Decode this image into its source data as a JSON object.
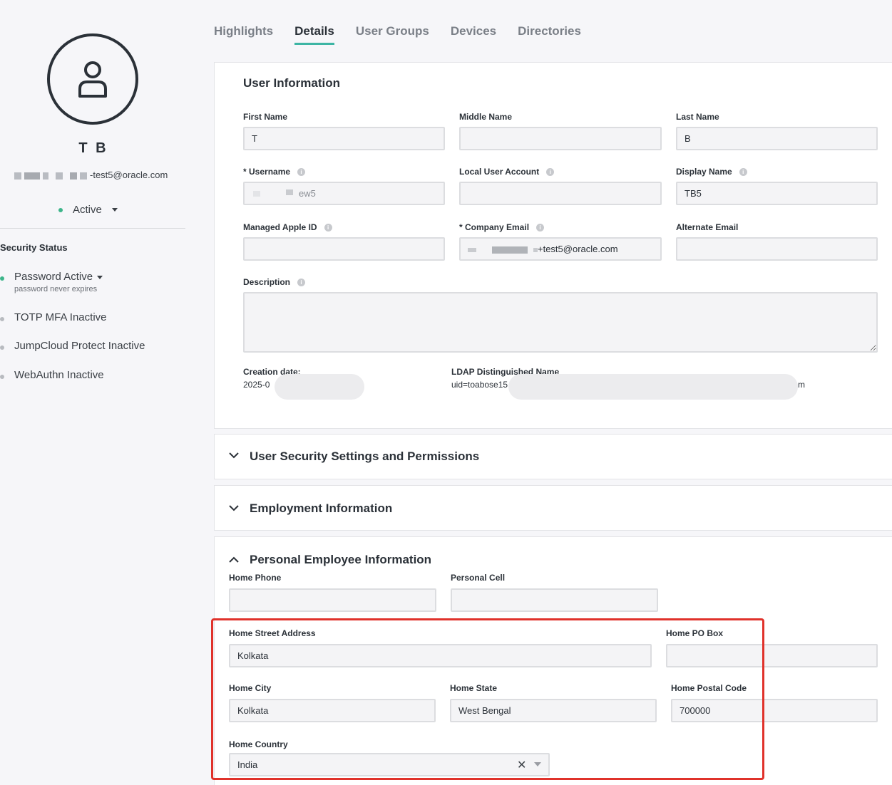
{
  "profile": {
    "initials": "T B",
    "email_visible": "-test5@oracle.com",
    "status": "Active",
    "status_color": "#3db58a"
  },
  "security": {
    "title": "Security Status",
    "items": [
      {
        "label": "Password Active",
        "sub": "password never expires",
        "color": "#3db58a",
        "dropdown": true
      },
      {
        "label": "TOTP MFA Inactive",
        "color": "#b8bbc0"
      },
      {
        "label": "JumpCloud Protect Inactive",
        "color": "#b8bbc0"
      },
      {
        "label": "WebAuthn Inactive",
        "color": "#b8bbc0"
      }
    ]
  },
  "tabs": [
    "Highlights",
    "Details",
    "User Groups",
    "Devices",
    "Directories"
  ],
  "active_tab": "Details",
  "user_info": {
    "title": "User Information",
    "first_name": {
      "label": "First Name",
      "value": "T"
    },
    "middle_name": {
      "label": "Middle Name",
      "value": ""
    },
    "last_name": {
      "label": "Last Name",
      "value": "B"
    },
    "username": {
      "label": "* Username",
      "value": "ew5"
    },
    "local_account": {
      "label": "Local User Account",
      "value": ""
    },
    "display_name": {
      "label": "Display Name",
      "value": "TB5"
    },
    "apple_id": {
      "label": "Managed Apple ID",
      "value": ""
    },
    "company_email": {
      "label": "* Company Email",
      "value": "+test5@oracle.com"
    },
    "alt_email": {
      "label": "Alternate Email",
      "value": ""
    },
    "description": {
      "label": "Description",
      "value": ""
    },
    "creation_label": "Creation date:",
    "creation_value": "2025-0",
    "ldap_label": "LDAP Distinguished Name",
    "ldap_value": "uid=toabose15",
    "ldap_tail": "m"
  },
  "sections": {
    "security_settings": "User Security Settings and Permissions",
    "employment": "Employment Information",
    "personal": "Personal Employee Information"
  },
  "personal": {
    "home_phone": {
      "label": "Home Phone",
      "value": ""
    },
    "personal_cell": {
      "label": "Personal Cell",
      "value": ""
    },
    "street": {
      "label": "Home Street Address",
      "value": "Kolkata"
    },
    "po_box": {
      "label": "Home PO Box",
      "value": ""
    },
    "city": {
      "label": "Home City",
      "value": "Kolkata"
    },
    "state": {
      "label": "Home State",
      "value": "West Bengal"
    },
    "postal": {
      "label": "Home Postal Code",
      "value": "700000"
    },
    "country": {
      "label": "Home Country",
      "value": "India"
    }
  },
  "highlight_color": "#e0322b"
}
